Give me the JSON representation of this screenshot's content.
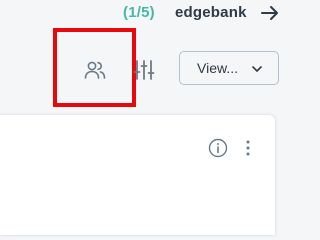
{
  "header": {
    "progress": "(1/5)",
    "account_name": "edgebank"
  },
  "toolbar": {
    "view_label": "View..."
  },
  "icons": {
    "next": "arrow-right-icon",
    "people": "people-icon",
    "filter": "sliders-icon",
    "dropdown": "chevron-down-icon",
    "info": "info-icon",
    "more": "more-vertical-icon"
  },
  "colors": {
    "accent": "#47b8a6",
    "highlight": "#e8090d",
    "text": "#2f3a45",
    "icon": "#6b7a88",
    "background": "#f4f6f8",
    "card": "#ffffff"
  }
}
